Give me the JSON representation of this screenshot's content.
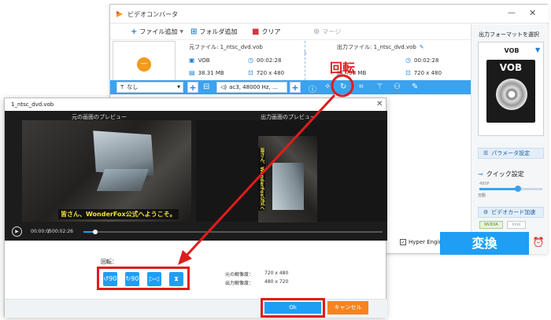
{
  "app": {
    "title": "ビデオコンバータ",
    "min_glyph": "—",
    "close_glyph": "✕"
  },
  "toolbar": {
    "add_file": "ファイル追加",
    "add_folder": "フォルダ追加",
    "clear": "クリア",
    "merge": "マージ"
  },
  "file": {
    "thumb_glyph": "—",
    "source_label": "元ファイル: 1_ntsc_dvd.vob",
    "output_label": "出力ファイル: 1_ntsc_dvd.vob",
    "src_format": "VOB",
    "src_duration": "00:02:28",
    "src_size": "38.31 MB",
    "src_resolution": "720 x 480",
    "out_duration": "00:02:28",
    "out_size": "?58 MB",
    "out_resolution": "720 x 480"
  },
  "callout": {
    "rotate_text": "回転"
  },
  "edit_bar": {
    "subtitle_value": "なし",
    "audio_value": "ac3, 48000 Hz, ..."
  },
  "right_panel": {
    "output_format_label": "出力フォーマットを選択",
    "format_name": "VOB",
    "format_box_label": "VOB",
    "param_settings": "パラメータ設定",
    "quick_settings": "クイック設定",
    "slider_top_label": "480P",
    "auto_label": "自動",
    "gpu_accel": "ビデオカード加速",
    "nvidia": "NVIDIA",
    "intel": "Intel"
  },
  "bottom": {
    "hyper_engine": "Hyper Engine",
    "convert": "変換"
  },
  "dialog": {
    "title": "1_ntsc_dvd.vob",
    "close_glyph": "✕",
    "source_preview": "元の画面のプレビュー",
    "output_preview": "出力画面のプレビュー",
    "caption": "皆さん、WonderFox公式へようこそ。",
    "time_current": "00:00:05",
    "time_sep": "/",
    "time_total": "00:02:26",
    "seek_progress": 0.04,
    "rotate_label": "回転：",
    "rotate_buttons": [
      "↺90",
      "↻90",
      "▷◁",
      "⧗"
    ],
    "src_res_label": "元の解像度：",
    "src_res_value": "720 x 480",
    "out_res_label": "出力解像度：",
    "out_res_value": "480 x 720",
    "ok": "Ok",
    "cancel": "キャンセル"
  },
  "colors": {
    "accent": "#1f9ef4",
    "callout_red": "#e01c1c",
    "cancel_orange": "#f6831f"
  }
}
